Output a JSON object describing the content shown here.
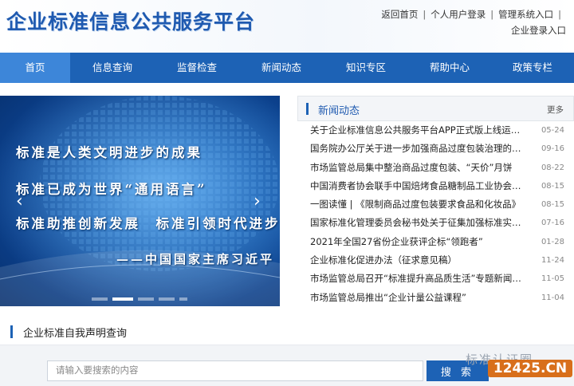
{
  "header": {
    "logo_text": "企业标准信息公共服务平台",
    "links_row1": [
      "返回首页",
      "个人用户登录",
      "管理系统入口"
    ],
    "link_row2": "企业登录入口",
    "separator": "|"
  },
  "nav": {
    "items": [
      "首页",
      "信息查询",
      "监督检查",
      "新闻动态",
      "知识专区",
      "帮助中心",
      "政策专栏"
    ],
    "active_index": 0
  },
  "banner": {
    "lines": [
      "标准是人类文明进步的成果",
      "标准已成为世界“通用语言”",
      "标准助推创新发展　标准引领时代进步",
      "——中国国家主席习近平"
    ],
    "prev_icon": "chevron-left-icon",
    "next_icon": "chevron-right-icon",
    "slide_count": 5,
    "active_slide": 1
  },
  "news": {
    "title": "新闻动态",
    "more": "更多",
    "items": [
      {
        "text": "关于企业标准信息公共服务平台APP正式版上线运行...",
        "date": "05-24"
      },
      {
        "text": "国务院办公厅关于进一步加强商品过度包装治理的通知",
        "date": "09-16"
      },
      {
        "text": "市场监管总局集中整治商品过度包装、“天价”月饼",
        "date": "08-22"
      },
      {
        "text": "中国消费者协会联手中国焙烤食品糖制品工业协会中...",
        "date": "08-15"
      },
      {
        "text": "一图读懂 | 《限制商品过度包装要求食品和化妆品》",
        "date": "08-15"
      },
      {
        "text": "国家标准化管理委员会秘书处关于征集加强标准实施...",
        "date": "07-16"
      },
      {
        "text": "2021年全国27省份企业获评企标“领跑者”",
        "date": "01-28"
      },
      {
        "text": "企业标准化促进办法（征求意见稿）",
        "date": "11-24"
      },
      {
        "text": "市场监管总局召开“标准提升高品质生活”专题新闻发...",
        "date": "11-05"
      },
      {
        "text": "市场监管总局推出“企业计量公益课程”",
        "date": "11-04"
      }
    ]
  },
  "query": {
    "title": "企业标准自我声明查询",
    "placeholder": "请输入要搜索的内容",
    "button_label": "搜 索"
  },
  "watermark": {
    "text": "标准认证圈",
    "badge": "12425.CN"
  },
  "colors": {
    "brand": "#1d62b5",
    "nav_active": "#3d86d9",
    "badge": "#d86f1b"
  }
}
